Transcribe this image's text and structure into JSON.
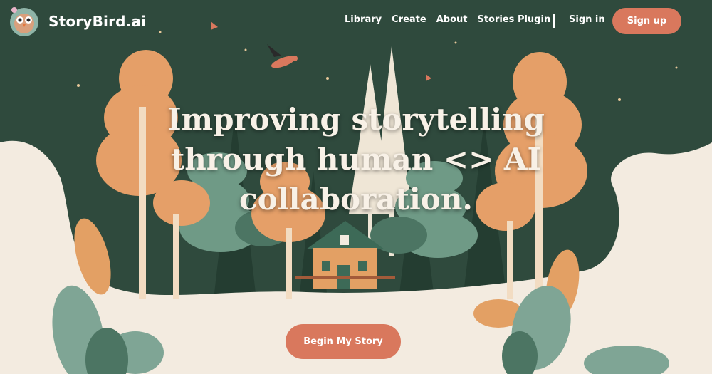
{
  "brand": {
    "name": "StoryBird.ai",
    "logo_icon": "bird-mascot-icon"
  },
  "nav": {
    "links": [
      "Library",
      "Create",
      "About",
      "Stories Plugin"
    ],
    "signin_label": "Sign in",
    "signup_label": "Sign up"
  },
  "hero": {
    "headline_lines": [
      "Improving storytelling",
      "through human <> AI",
      "collaboration."
    ],
    "cta_label": "Begin My Story"
  },
  "colors": {
    "forest_green": "#2f4a3d",
    "cream": "#f3ebe0",
    "accent_coral": "#d9785d",
    "tree_orange": "#e59f68"
  }
}
